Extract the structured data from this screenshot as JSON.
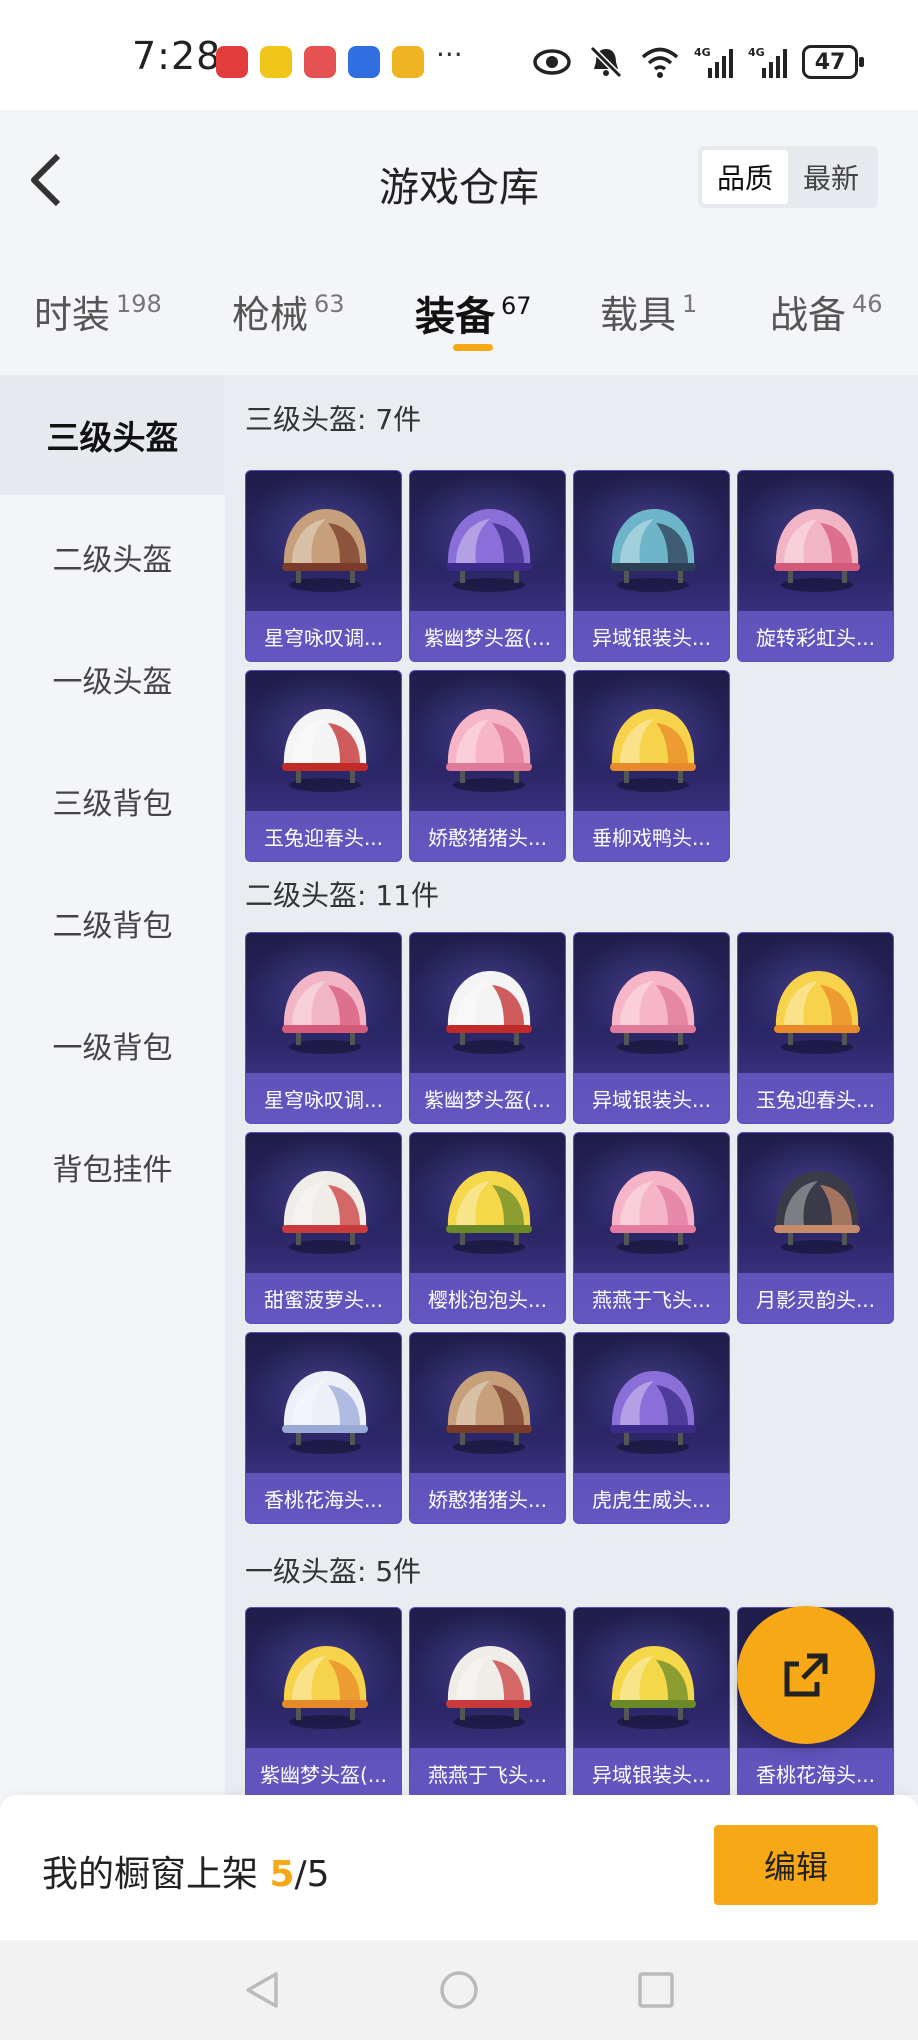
{
  "status_bar": {
    "time": "7:28",
    "dots": "···",
    "battery": "47"
  },
  "header": {
    "title": "游戏仓库",
    "sort_options": [
      "品质",
      "最新"
    ]
  },
  "tabs": [
    {
      "label": "时装",
      "count": "198"
    },
    {
      "label": "枪械",
      "count": "63"
    },
    {
      "label": "装备",
      "count": "67"
    },
    {
      "label": "载具",
      "count": "1"
    },
    {
      "label": "战备",
      "count": "46"
    }
  ],
  "sidebar": [
    "三级头盔",
    "二级头盔",
    "一级头盔",
    "三级背包",
    "二级背包",
    "一级背包",
    "背包挂件"
  ],
  "groups": [
    {
      "title": "三级头盔: 7件",
      "items": [
        "星穹咏叹调...",
        "紫幽梦头盔(...",
        "异域银装头...",
        "旋转彩虹头...",
        "玉兔迎春头...",
        "娇憨猪猪头...",
        "垂柳戏鸭头..."
      ]
    },
    {
      "title": "二级头盔: 11件",
      "items": [
        "星穹咏叹调...",
        "紫幽梦头盔(...",
        "异域银装头...",
        "玉兔迎春头...",
        "甜蜜菠萝头...",
        "樱桃泡泡头...",
        "燕燕于飞头...",
        "月影灵韵头...",
        "香桃花海头...",
        "娇憨猪猪头...",
        "虎虎生威头..."
      ]
    },
    {
      "title": "一级头盔: 5件",
      "items": [
        "紫幽梦头盔(...",
        "燕燕于飞头...",
        "异域银装头...",
        "香桃花海头..."
      ]
    }
  ],
  "bottom": {
    "showcase_label": "我的橱窗上架 ",
    "showcase_current": "5",
    "showcase_total": "/5",
    "edit_label": "编辑"
  },
  "colors": {
    "accent": "#f7a816",
    "card_bg": "#2c2768",
    "card_label": "#6e5fcd"
  },
  "icons": [
    "back-icon",
    "share-icon",
    "eye-icon",
    "mute-icon",
    "wifi-icon",
    "signal-icon",
    "battery-icon",
    "nav-back-icon",
    "nav-home-icon",
    "nav-recent-icon"
  ]
}
